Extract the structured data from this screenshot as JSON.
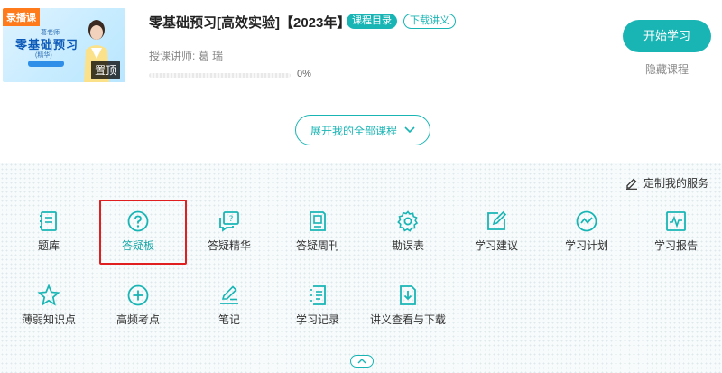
{
  "course": {
    "thumb_tag": "录播课",
    "thumb_teacher_caption": "葛老师",
    "thumb_title": "零基础预习",
    "thumb_sub": "(精华)",
    "pin_label": "置顶",
    "title": "零基础预习[高效实验]【2023年】",
    "catalog_badge": "课程目录",
    "download_badge": "下载讲义",
    "teacher_line": "授课讲师:   葛  瑞",
    "progress_percent": 0,
    "progress_text": "0%"
  },
  "actions": {
    "start_label": "开始学习",
    "hide_label": "隐藏课程",
    "expand_label": "展开我的全部课程"
  },
  "services": {
    "customize_label": "定制我的服务",
    "items": [
      {
        "label": "题库",
        "icon": "question-bank-icon"
      },
      {
        "label": "答疑板",
        "icon": "qa-board-icon"
      },
      {
        "label": "答疑精华",
        "icon": "qa-highlights-icon"
      },
      {
        "label": "答疑周刊",
        "icon": "qa-weekly-icon"
      },
      {
        "label": "勘误表",
        "icon": "errata-icon"
      },
      {
        "label": "学习建议",
        "icon": "study-advice-icon"
      },
      {
        "label": "学习计划",
        "icon": "study-plan-icon"
      },
      {
        "label": "学习报告",
        "icon": "study-report-icon"
      },
      {
        "label": "薄弱知识点",
        "icon": "weak-points-icon"
      },
      {
        "label": "高频考点",
        "icon": "high-frequency-icon"
      },
      {
        "label": "笔记",
        "icon": "notes-icon"
      },
      {
        "label": "学习记录",
        "icon": "study-record-icon"
      },
      {
        "label": "讲义查看与下载",
        "icon": "handout-download-icon"
      }
    ]
  },
  "colors": {
    "accent": "#19b5b5",
    "highlight_border": "#e02020",
    "badge_orange": "#ff7a1a"
  }
}
